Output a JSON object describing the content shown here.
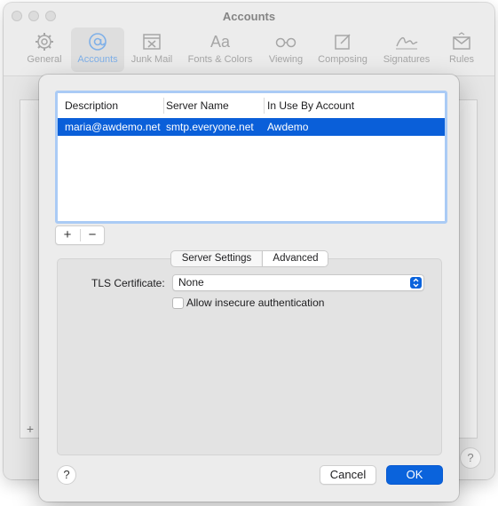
{
  "window": {
    "title": "Accounts"
  },
  "toolbar": {
    "items": [
      {
        "label": "General",
        "icon": "gear-icon"
      },
      {
        "label": "Accounts",
        "icon": "at-sign-icon",
        "active": true
      },
      {
        "label": "Junk Mail",
        "icon": "junk-tray-icon"
      },
      {
        "label": "Fonts & Colors",
        "icon": "font-aa-icon"
      },
      {
        "label": "Viewing",
        "icon": "glasses-icon"
      },
      {
        "label": "Composing",
        "icon": "compose-pencil-icon"
      },
      {
        "label": "Signatures",
        "icon": "signature-icon"
      },
      {
        "label": "Rules",
        "icon": "rules-envelope-icon"
      }
    ]
  },
  "sheet": {
    "table": {
      "columns": [
        "Description",
        "Server Name",
        "In Use By Account"
      ],
      "rows": [
        {
          "description": "maria@awdemo.net",
          "server": "smtp.everyone.net",
          "account": "Awdemo",
          "selected": true
        }
      ]
    },
    "add_button": "+",
    "remove_button": "−",
    "tabs": {
      "server_settings": "Server Settings",
      "advanced": "Advanced",
      "selected": "Advanced"
    },
    "tls": {
      "label": "TLS Certificate:",
      "value": "None"
    },
    "checkbox": {
      "label": "Allow insecure authentication",
      "checked": false
    },
    "help_button": "?",
    "cancel_button": "Cancel",
    "ok_button": "OK"
  },
  "background": {
    "plus_button": "+",
    "help_button": "?"
  },
  "colors": {
    "accent": "#0a63dc",
    "selection": "#0a5fd9",
    "focus_ring": "#aacbf5"
  }
}
